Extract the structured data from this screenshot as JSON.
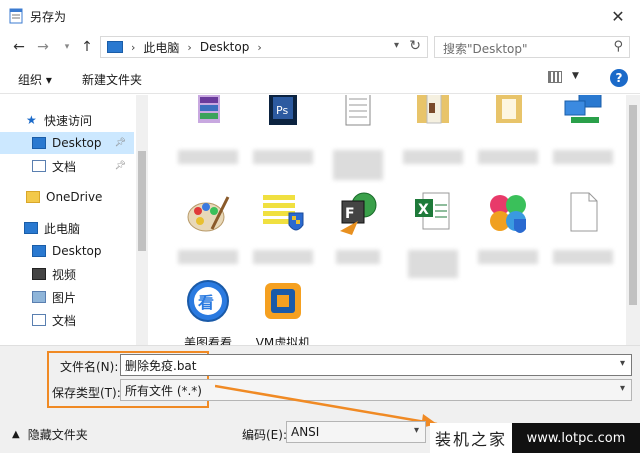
{
  "window": {
    "title": "另存为"
  },
  "address": {
    "crumbs": [
      "此电脑",
      "Desktop"
    ]
  },
  "search": {
    "placeholder": "搜索\"Desktop\""
  },
  "toolbar": {
    "organize": "组织 ▾",
    "new_folder": "新建文件夹"
  },
  "sidebar": {
    "items": [
      {
        "label": "快速访问"
      },
      {
        "label": "Desktop"
      },
      {
        "label": "文档"
      },
      {
        "label": "OneDrive"
      },
      {
        "label": "此电脑"
      },
      {
        "label": "Desktop"
      },
      {
        "label": "视频"
      },
      {
        "label": "图片"
      },
      {
        "label": "文档"
      }
    ]
  },
  "files": [
    {
      "icon": "winrar-archive-icon",
      "label": ""
    },
    {
      "icon": "photoshop-icon",
      "label": ""
    },
    {
      "icon": "text-document-icon",
      "label": ""
    },
    {
      "icon": "folder-icon",
      "label": ""
    },
    {
      "icon": "folder-icon",
      "label": ""
    },
    {
      "icon": "network-icon",
      "label": ""
    },
    {
      "icon": "paint-palette-icon",
      "label": ""
    },
    {
      "icon": "shield-list-icon",
      "label": ""
    },
    {
      "icon": "flashfxp-icon",
      "label": ""
    },
    {
      "icon": "excel-icon",
      "label": ""
    },
    {
      "icon": "colorful-app-icon",
      "label": ""
    },
    {
      "icon": "blank-file-icon",
      "label": ""
    },
    {
      "icon": "meitu-viewer-icon",
      "label": "美图看看"
    },
    {
      "icon": "vmware-icon",
      "label": "VM虚拟机"
    }
  ],
  "form": {
    "filename_label": "文件名(N):",
    "filename_value": "删除免疫.bat",
    "filetype_label": "保存类型(T):",
    "filetype_value": "所有文件  (*.*)",
    "encoding_label": "编码(E):",
    "encoding_value": "ANSI"
  },
  "hide_folders": "隐藏文件夹",
  "watermark": {
    "text": "装机之家",
    "url": "www.lotpc.com"
  },
  "colors": {
    "accent": "#1b6ac9",
    "highlight": "#f08a24",
    "selection": "#cce8ff"
  }
}
